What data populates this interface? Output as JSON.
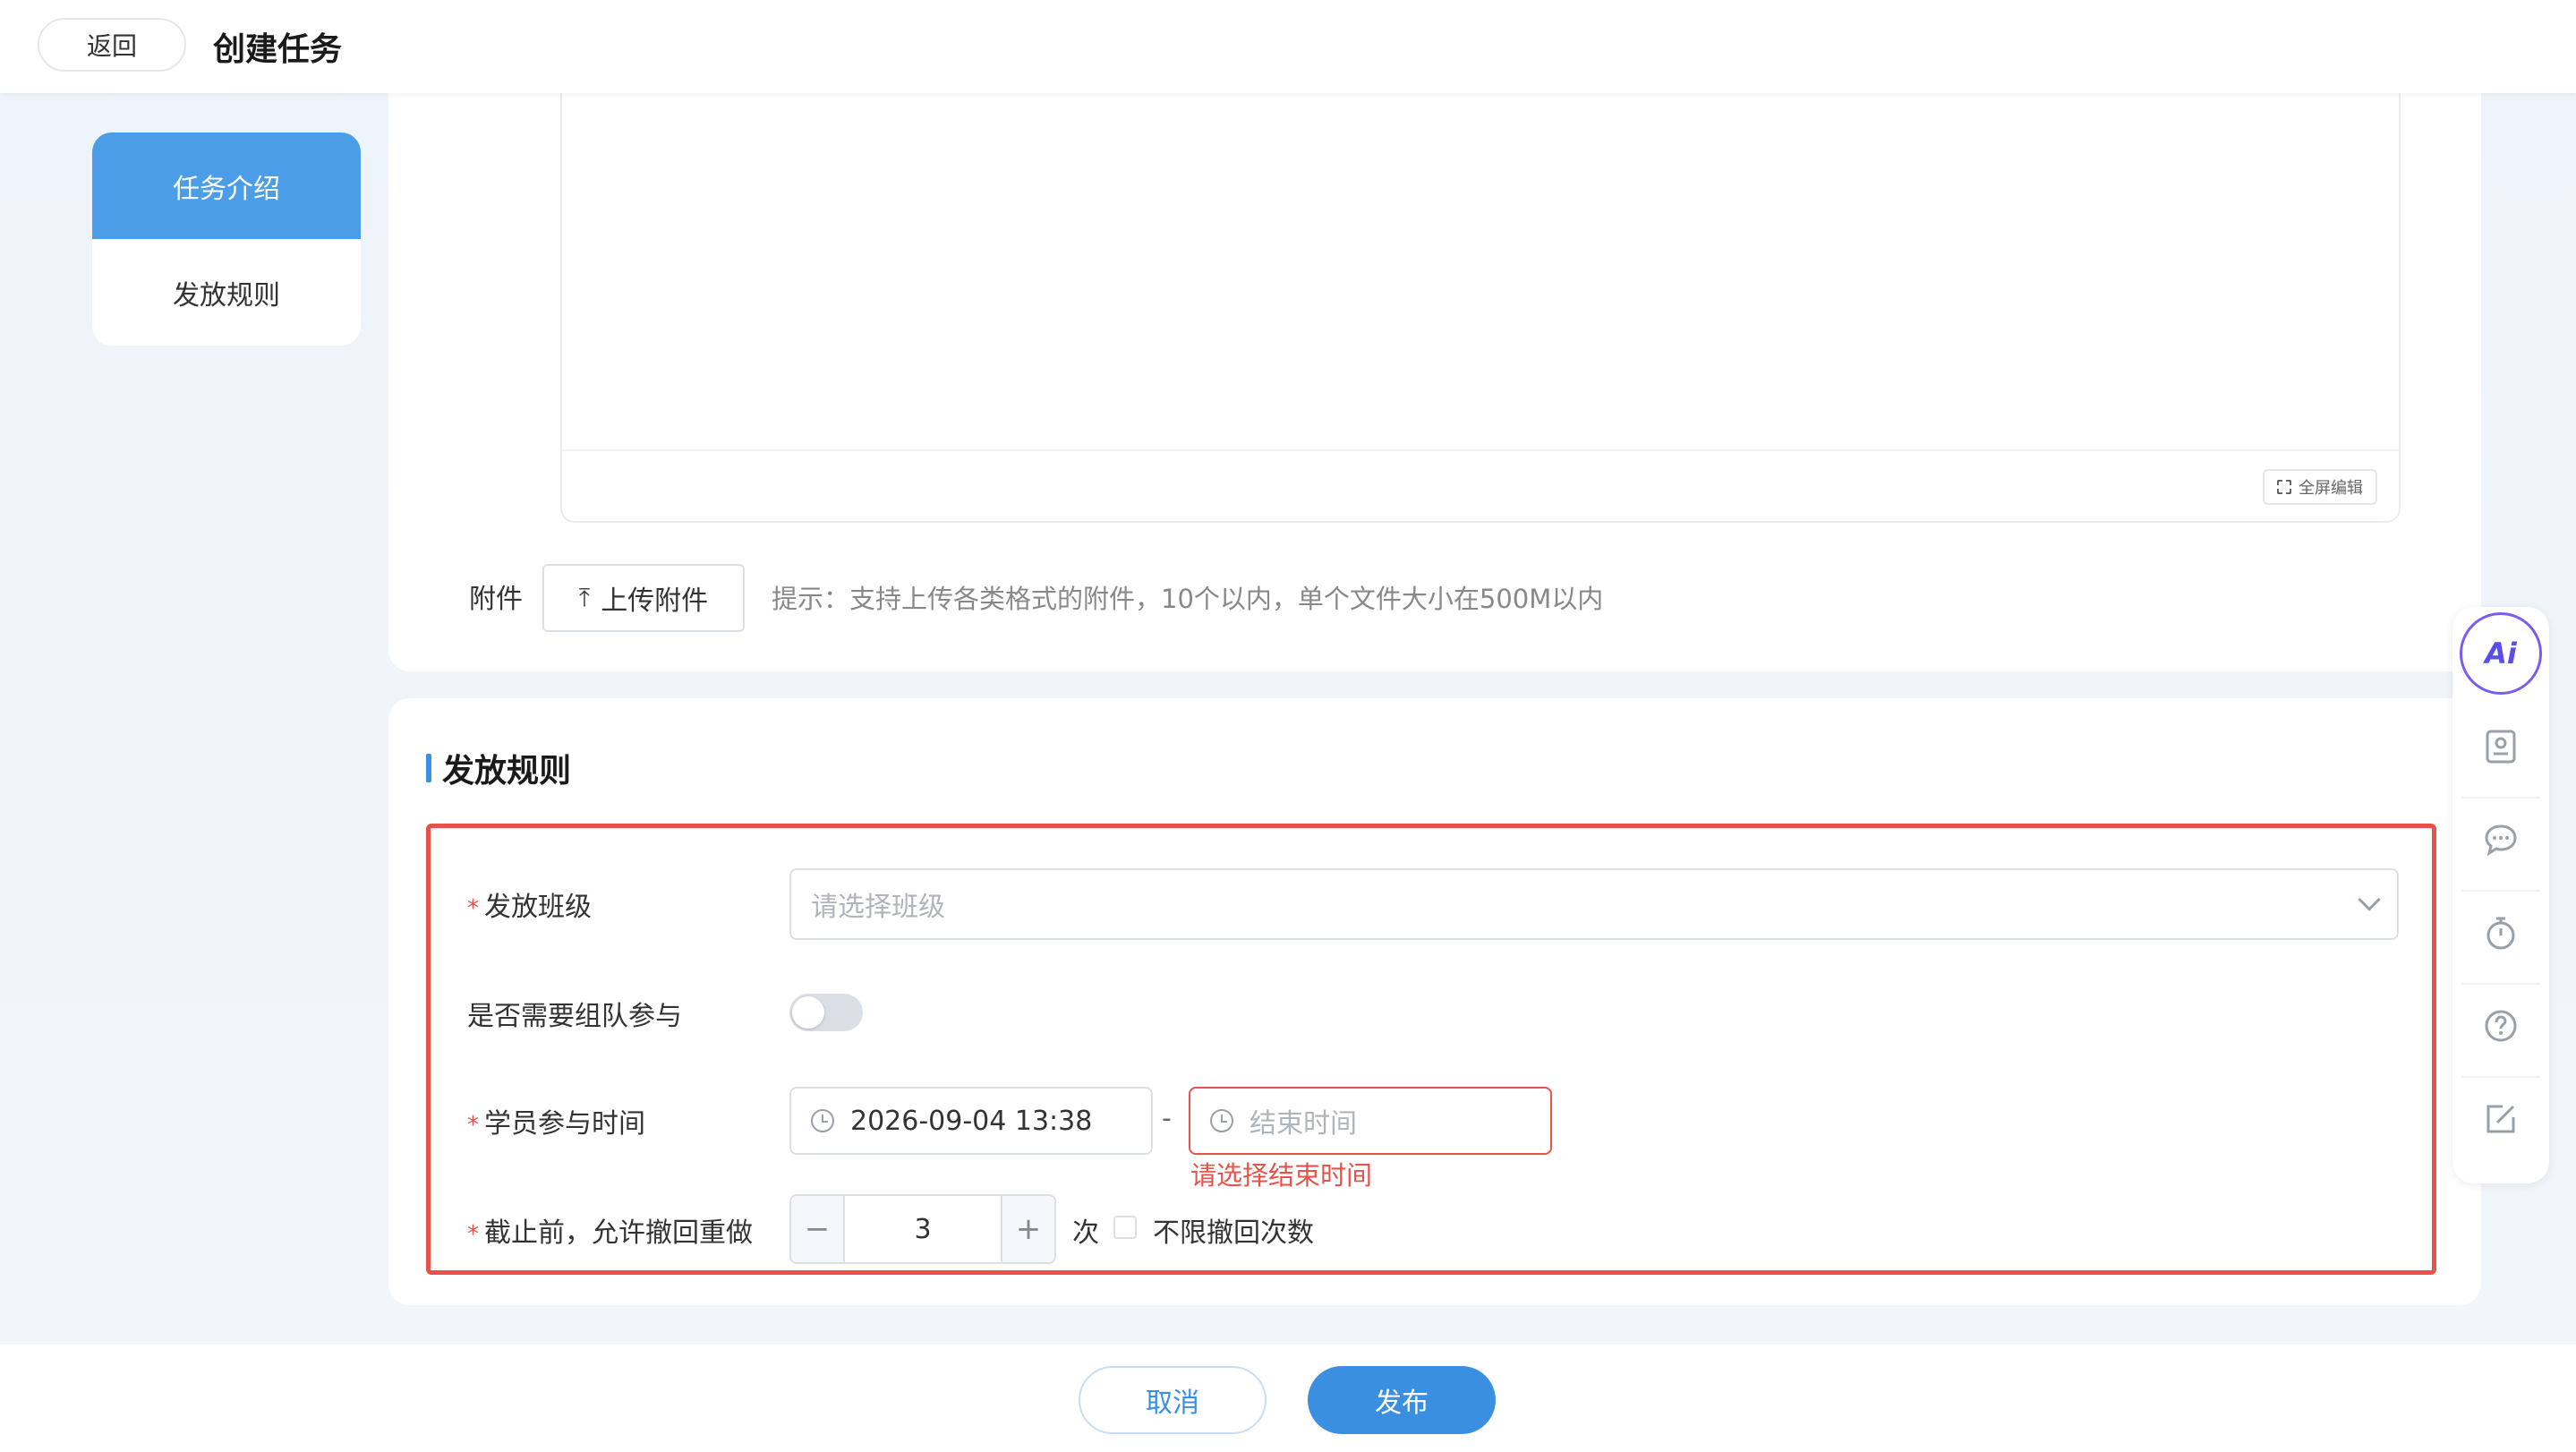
{
  "header": {
    "back_label": "返回",
    "title": "创建任务"
  },
  "left_nav": {
    "items": [
      {
        "label": "任务介绍",
        "active": true
      },
      {
        "label": "发放规则",
        "active": false
      }
    ]
  },
  "editor": {
    "fullscreen_label": "全屏编辑"
  },
  "attachment": {
    "label": "附件",
    "upload_label": "上传附件",
    "hint": "提示：支持上传各类格式的附件，10个以内，单个文件大小在500M以内"
  },
  "rules": {
    "section_title": "发放规则",
    "class_label": "发放班级",
    "class_placeholder": "请选择班级",
    "team_label": "是否需要组队参与",
    "team_enabled": false,
    "time_label": "学员参与时间",
    "start_time": "2026-09-04 13:38",
    "range_separator": "-",
    "end_placeholder": "结束时间",
    "end_error": "请选择结束时间",
    "redo_label": "截止前，允许撤回重做",
    "redo_count": "3",
    "redo_minus": "−",
    "redo_plus": "+",
    "redo_unit": "次",
    "unlimited_label": "不限撤回次数",
    "unlimited_checked": false
  },
  "right_toolbar": {
    "ai_label": "Ai",
    "icons": [
      "contact-card-icon",
      "chat-bubble-icon",
      "stopwatch-icon",
      "help-circle-icon",
      "edit-note-icon"
    ]
  },
  "footer": {
    "cancel_label": "取消",
    "publish_label": "发布"
  },
  "colors": {
    "primary": "#3b8fe0",
    "active_nav": "#4a9de6",
    "error": "#e8524a",
    "ai_accent": "#5a4ee8"
  }
}
